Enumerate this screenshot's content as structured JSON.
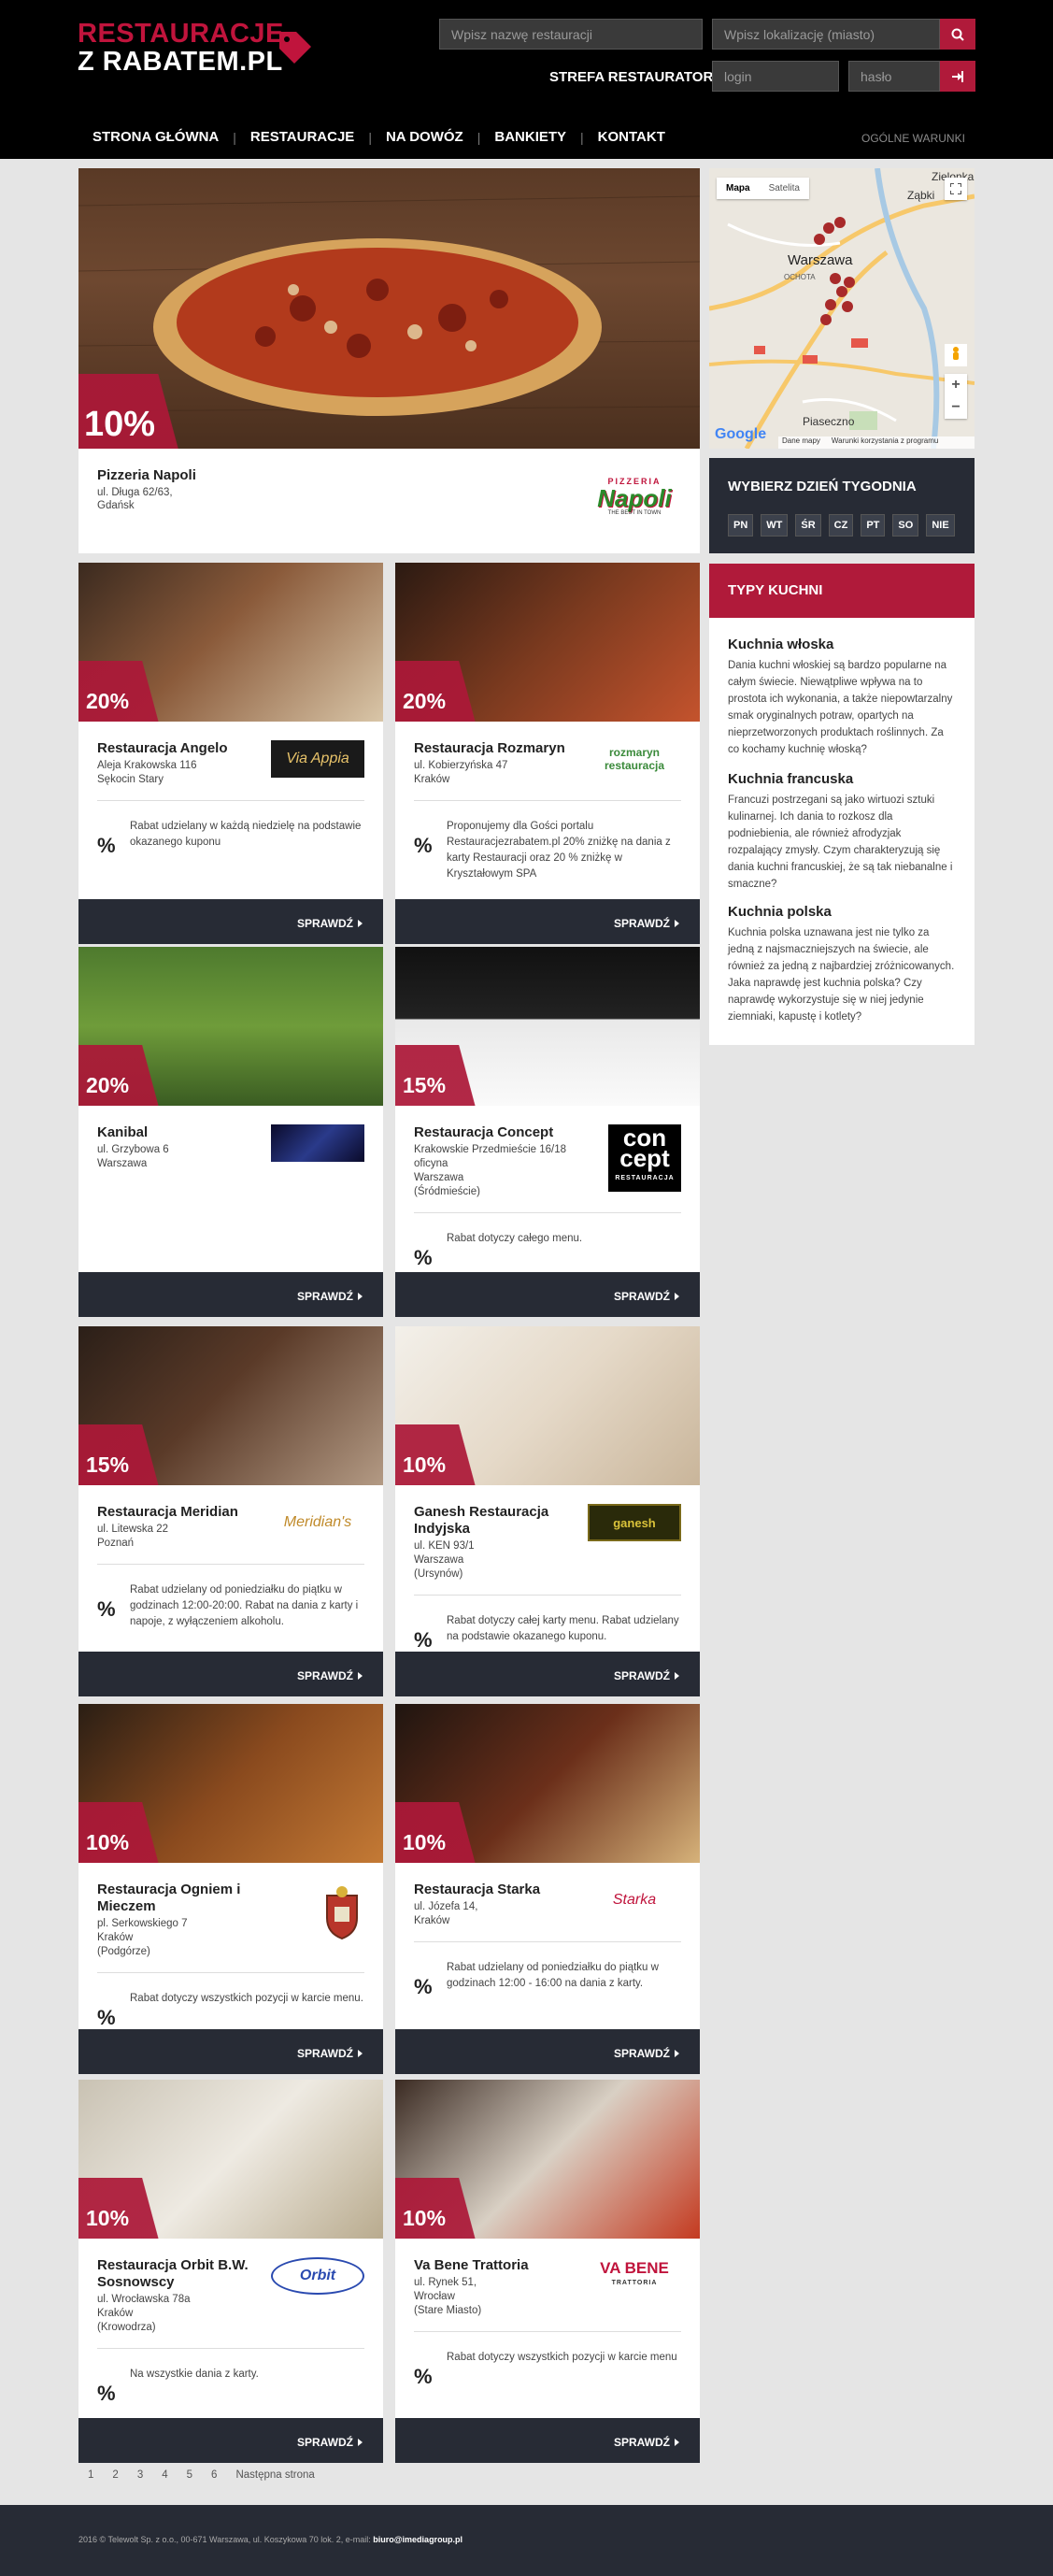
{
  "header": {
    "logo_line1": "RESTAURACJE",
    "logo_line2": "Z RABATEM.PL",
    "search_name_placeholder": "Wpisz nazwę restauracji",
    "search_location_placeholder": "Wpisz lokalizację (miasto)",
    "zone_label": "STREFA RESTAURATORA",
    "login_placeholder": "login",
    "password_placeholder": "hasło",
    "terms": "OGÓLNE WARUNKI",
    "brand_color": "#b01a3a"
  },
  "nav": [
    "STRONA GŁÓWNA",
    "RESTAURACJE",
    "NA DOWÓZ",
    "BANKIETY",
    "KONTAKT"
  ],
  "featured": {
    "discount": "10%",
    "name": "Pizzeria Napoli",
    "addr1": "ul. Długa 62/63,",
    "addr2": "Gdańsk",
    "logo_text": "Napoli",
    "logo_top": "PIZZERIA",
    "logo_sub": "THE BEST IN TOWN"
  },
  "button_label": "SPRAWDŹ",
  "percent_symbol": "%",
  "restaurants": [
    {
      "name": "Restauracja Angelo",
      "discount": "20%",
      "addr": [
        "Aleja Krakowska 116",
        "Sękocin Stary"
      ],
      "desc": "Rabat udzielany w każdą niedzielę na podstawie okazanego kuponu",
      "logo_text": "Via Appia"
    },
    {
      "name": "Restauracja Rozmaryn",
      "discount": "20%",
      "addr": [
        "ul. Kobierzyńska 47",
        "Kraków"
      ],
      "desc": "Proponujemy dla Gości portalu Restauracjezrabatem.pl 20% zniżkę na dania z karty Restauracji oraz 20 % zniżkę w Kryształowym SPA",
      "logo_text": "rozmaryn restauracja"
    },
    {
      "name": "Kanibal",
      "discount": "20%",
      "addr": [
        "ul. Grzybowa 6",
        "Warszawa"
      ],
      "desc": "",
      "logo_text": ""
    },
    {
      "name": "Restauracja Concept",
      "discount": "15%",
      "addr": [
        "Krakowskie Przedmieście 16/18",
        "oficyna",
        "Warszawa",
        "(Śródmieście)"
      ],
      "desc": "Rabat dotyczy całego menu.",
      "logo_text": "con cept",
      "logo_sub": "RESTAURACJA"
    },
    {
      "name": "Restauracja Meridian",
      "discount": "15%",
      "addr": [
        "ul. Litewska 22",
        "Poznań"
      ],
      "desc": "Rabat udzielany od poniedziałku do piątku w godzinach 12:00-20:00. Rabat na dania z karty i napoje, z wyłączeniem alkoholu.",
      "logo_text": "Meridian's"
    },
    {
      "name": "Ganesh Restauracja Indyjska",
      "discount": "10%",
      "addr": [
        "ul. KEN 93/1",
        "Warszawa",
        "(Ursynów)"
      ],
      "desc": "Rabat dotyczy całej karty menu. Rabat udzielany na podstawie okazanego kuponu.",
      "logo_text": "ganesh"
    },
    {
      "name": "Restauracja Ogniem i Mieczem",
      "discount": "10%",
      "addr": [
        "pl. Serkowskiego 7",
        "Kraków",
        "(Podgórze)"
      ],
      "desc": "Rabat dotyczy wszystkich pozycji w karcie menu.",
      "logo_text": ""
    },
    {
      "name": "Restauracja Starka",
      "discount": "10%",
      "addr": [
        "ul. Józefa 14,",
        "Kraków"
      ],
      "desc": "Rabat udzielany od poniedziałku do piątku w godzinach 12:00 - 16:00 na dania z karty.",
      "logo_text": "Starka"
    },
    {
      "name": "Restauracja Orbit B.W. Sosnowscy",
      "discount": "10%",
      "addr": [
        "ul. Wrocławska 78a",
        "Kraków",
        "(Krowodrza)"
      ],
      "desc": "Na wszystkie dania z karty.",
      "logo_text": "Orbit"
    },
    {
      "name": "Va Bene Trattoria",
      "discount": "10%",
      "addr": [
        "ul. Rynek 51,",
        "Wrocław",
        "(Stare Miasto)"
      ],
      "desc": "Rabat dotyczy wszystkich pozycji w karcie menu",
      "logo_text": "VA BENE",
      "logo_sub": "TRATTORIA"
    }
  ],
  "map": {
    "tab_map": "Mapa",
    "tab_satellite": "Satelita",
    "city": "Warszawa",
    "labels": [
      "Zielonka",
      "Ząbki",
      "Piaseczno",
      "OCHOTA"
    ],
    "footer_data": "Dane mapy",
    "footer_terms": "Warunki korzystania z programu",
    "google": "Google"
  },
  "days": {
    "title": "WYBIERZ DZIEŃ TYGODNIA",
    "items": [
      "PN",
      "WT",
      "ŚR",
      "CZ",
      "PT",
      "SO",
      "NIE"
    ]
  },
  "cuisine": {
    "title": "TYPY KUCHNI",
    "items": [
      {
        "name": "Kuchnia włoska",
        "text": "Dania kuchni włoskiej są bardzo popularne na całym świecie. Niewątpliwe wpływa na to prostota ich wykonania, a także niepowtarzalny smak oryginalnych potraw, opartych na nieprzetworzonych produktach roślinnych. Za co kochamy kuchnię włoską?"
      },
      {
        "name": "Kuchnia francuska",
        "text": "Francuzi postrzegani są jako wirtuozi sztuki kulinarnej. Ich dania to rozkosz dla podniebienia, ale również afrodyzjak rozpalający zmysły. Czym charakteryzują się dania kuchni francuskiej, że są tak niebanalne i smaczne?"
      },
      {
        "name": "Kuchnia polska",
        "text": "Kuchnia polska uznawana jest nie tylko za jedną z najsmaczniejszych na świecie, ale również za jedną z najbardziej zróżnicowanych. Jaka naprawdę jest kuchnia polska? Czy naprawdę wykorzystuje się w niej jedynie ziemniaki, kapustę i kotlety?"
      }
    ]
  },
  "pagination": [
    "1",
    "2",
    "3",
    "4",
    "5",
    "6",
    "Następna strona"
  ],
  "footer": {
    "text": "2016 © Telewolt Sp. z o.o., 00-671 Warszawa, ul. Koszykowa 70 lok. 2, e-mail: ",
    "email": "biuro@imediagroup.pl"
  }
}
